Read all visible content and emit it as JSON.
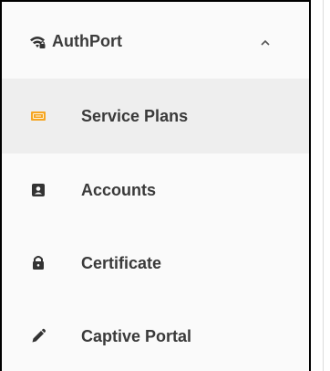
{
  "nav": {
    "group": {
      "label": "AuthPort",
      "icon": "wifi-lock-icon",
      "expanded": true
    },
    "items": [
      {
        "label": "Service Plans",
        "icon": "ticket-icon",
        "active": true,
        "accent": "#f5a623"
      },
      {
        "label": "Accounts",
        "icon": "id-card-icon",
        "active": false
      },
      {
        "label": "Certificate",
        "icon": "lock-icon",
        "active": false
      },
      {
        "label": "Captive Portal",
        "icon": "pencil-icon",
        "active": false
      }
    ]
  },
  "colors": {
    "active_row": "#eeeeee",
    "text": "#3a3a3a",
    "icon": "#333333"
  }
}
